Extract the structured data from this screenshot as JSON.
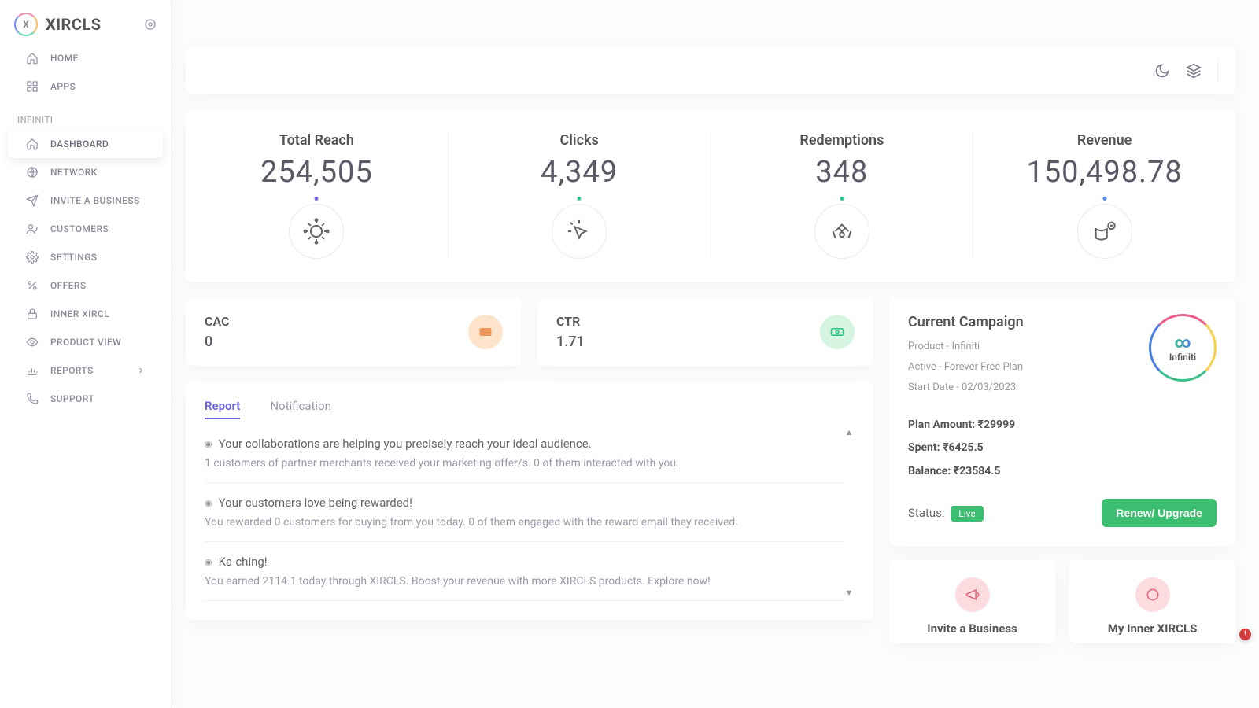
{
  "brand": {
    "name": "XIRCLS",
    "logo_letter": "X"
  },
  "sidebar": {
    "home": "HOME",
    "apps": "APPS",
    "section": "INFINITI",
    "items": [
      {
        "label": "DASHBOARD"
      },
      {
        "label": "NETWORK"
      },
      {
        "label": "INVITE A BUSINESS"
      },
      {
        "label": "CUSTOMERS"
      },
      {
        "label": "SETTINGS"
      },
      {
        "label": "OFFERS"
      },
      {
        "label": "INNER XIRCL"
      },
      {
        "label": "PRODUCT VIEW"
      },
      {
        "label": "REPORTS"
      },
      {
        "label": "SUPPORT"
      }
    ]
  },
  "kpis": {
    "reach": {
      "label": "Total Reach",
      "value": "254,505"
    },
    "clicks": {
      "label": "Clicks",
      "value": "4,349"
    },
    "redemptions": {
      "label": "Redemptions",
      "value": "348"
    },
    "revenue": {
      "label": "Revenue",
      "value": "150,498.78"
    }
  },
  "mini": {
    "cac": {
      "label": "CAC",
      "value": "0"
    },
    "ctr": {
      "label": "CTR",
      "value": "1.71"
    }
  },
  "tabs": {
    "report": "Report",
    "notification": "Notification"
  },
  "report": [
    {
      "title": "Your collaborations are helping you precisely reach your ideal audience.",
      "sub": "1 customers of partner merchants received your marketing offer/s. 0 of them interacted with you."
    },
    {
      "title": "Your customers love being rewarded!",
      "sub": "You rewarded 0 customers for buying from you today. 0 of them engaged with the reward email they received."
    },
    {
      "title": "Ka-ching!",
      "sub": "You earned 2114.1 today through XIRCLS. Boost your revenue with more XIRCLS products. Explore now!"
    }
  ],
  "campaign": {
    "title": "Current Campaign",
    "product_line": "Product - Infiniti",
    "active_line": "Active - Forever Free Plan",
    "start_line": "Start Date - 02/03/2023",
    "plan_label": "Plan Amount:",
    "plan_value": "₹29999",
    "spent_label": "Spent:",
    "spent_value": "₹6425.5",
    "balance_label": "Balance:",
    "balance_value": "₹23584.5",
    "status_label": "Status:",
    "status_badge": "Live",
    "renew_btn": "Renew/ Upgrade",
    "logo_text": "Infiniti"
  },
  "quick": {
    "invite": "Invite a Business",
    "inner": "My Inner XIRCLS"
  },
  "alert": "!"
}
